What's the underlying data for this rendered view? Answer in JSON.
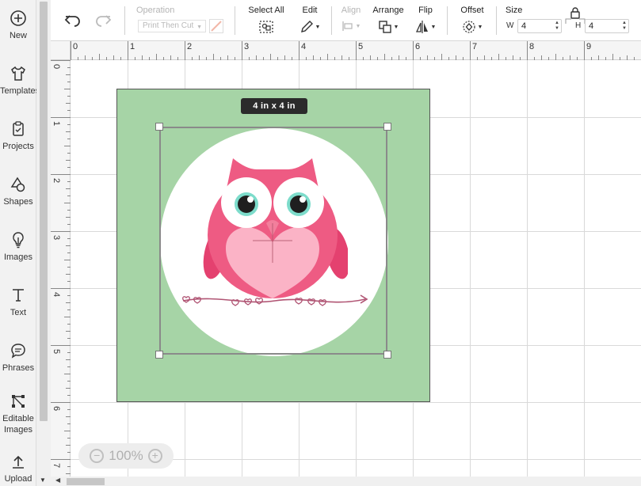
{
  "sidebar": {
    "items": [
      {
        "label": "New",
        "icon": "plus-circle-icon"
      },
      {
        "label": "Templates",
        "icon": "shirt-icon"
      },
      {
        "label": "Projects",
        "icon": "clipboard-icon"
      },
      {
        "label": "Shapes",
        "icon": "shapes-icon"
      },
      {
        "label": "Images",
        "icon": "lightbulb-icon"
      },
      {
        "label": "Text",
        "icon": "text-icon"
      },
      {
        "label": "Phrases",
        "icon": "speech-bubble-icon"
      },
      {
        "label": "Editable Images",
        "icon": "node-edit-icon"
      },
      {
        "label": "Upload",
        "icon": "upload-icon"
      }
    ]
  },
  "toolbar": {
    "undo_icon": "undo-icon",
    "redo_icon": "redo-icon",
    "operation_label": "Operation",
    "operation_value": "Print Then Cut",
    "select_all_label": "Select All",
    "edit_label": "Edit",
    "align_label": "Align",
    "arrange_label": "Arrange",
    "flip_label": "Flip",
    "offset_label": "Offset",
    "size_label": "Size",
    "width_letter": "W",
    "width_value": "4",
    "height_letter": "H",
    "height_value": "4"
  },
  "rulers": {
    "top": [
      "0",
      "1",
      "2",
      "3",
      "4",
      "5",
      "6",
      "7",
      "8",
      "9"
    ],
    "left": [
      "0",
      "1",
      "2",
      "3",
      "4",
      "5",
      "6",
      "7"
    ]
  },
  "canvas": {
    "dimension_badge": "4 in x 4 in",
    "mat_color": "#a6d4a6"
  },
  "zoom": {
    "value": "100%",
    "minus": "−",
    "plus": "+"
  }
}
